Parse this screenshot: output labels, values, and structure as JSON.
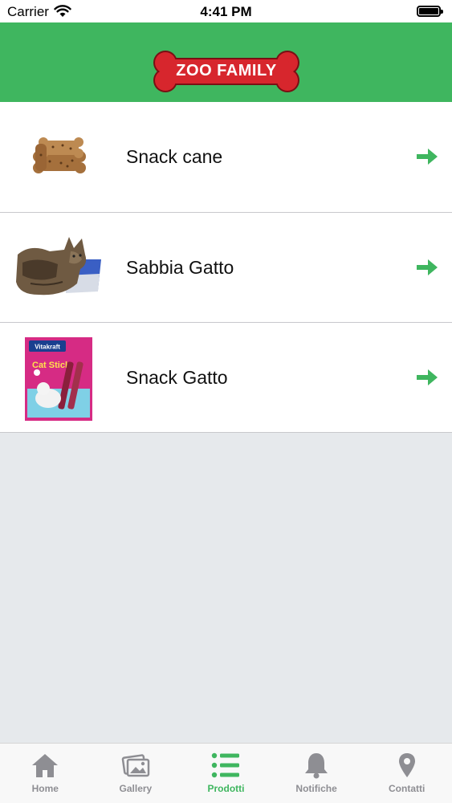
{
  "status_bar": {
    "carrier": "Carrier",
    "time": "4:41 PM"
  },
  "header": {
    "logo_text": "ZOO FAMILY",
    "brand_color": "#3fb65f",
    "logo_color": "#d7262d"
  },
  "products": [
    {
      "label": "Snack cane",
      "thumb": "dog-biscuit-image"
    },
    {
      "label": "Sabbia Gatto",
      "thumb": "cat-litter-image"
    },
    {
      "label": "Snack Gatto",
      "thumb": "cat-stick-package-image"
    }
  ],
  "package_text": {
    "brand": "Vitakraft",
    "product": "Cat Stick"
  },
  "tabs": [
    {
      "label": "Home",
      "icon": "home-icon",
      "active": false
    },
    {
      "label": "Gallery",
      "icon": "gallery-icon",
      "active": false
    },
    {
      "label": "Prodotti",
      "icon": "list-icon",
      "active": true
    },
    {
      "label": "Notifiche",
      "icon": "bell-icon",
      "active": false
    },
    {
      "label": "Contatti",
      "icon": "location-pin-icon",
      "active": false
    }
  ],
  "colors": {
    "active_tab": "#3fb65f",
    "inactive_tab": "#8e8e93",
    "arrow": "#3fb65f"
  }
}
